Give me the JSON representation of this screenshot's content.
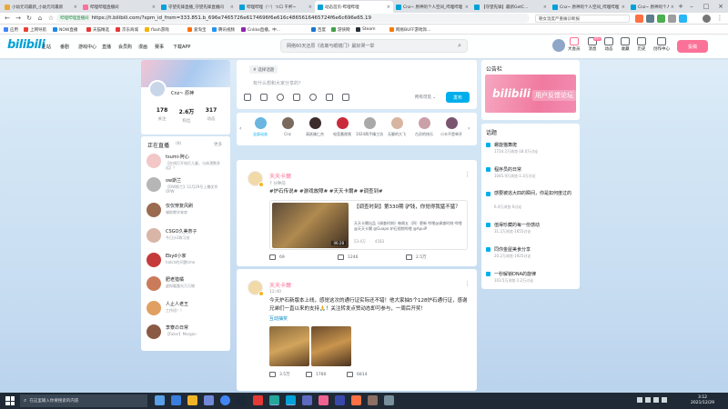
{
  "browser": {
    "tabs": [
      {
        "title": "小幼元司最新_小幼元司最新",
        "color": "#e8a83a"
      },
      {
        "title": "哔哩哔哩直播间",
        "color": "#fb7299"
      },
      {
        "title": "守望先锋直播_守望先锋直播间",
        "color": "#00a1d6"
      },
      {
        "title": "哔哩哔哩（'-'）つロ 干杯~",
        "color": "#00a1d6"
      },
      {
        "title": "动态首页-哔哩哔哩",
        "color": "#00a1d6",
        "active": true
      },
      {
        "title": "Cnz~ 原神的个人空间_哔哩哔哩",
        "color": "#00a1d6"
      },
      {
        "title": "【守望先锋】最新GetC...",
        "color": "#00a1d6"
      },
      {
        "title": "Cnz~ 原神的个人空间_哔哩哔哩",
        "color": "#00a1d6"
      },
      {
        "title": "Cnz~ 原神的个人空间_哔哩哔哩",
        "color": "#00a1d6"
      }
    ],
    "new_tab": "+",
    "url_secure": "哔哩哔哩直播间",
    "url": "https://t.bilibili.com/?spm_id_from=333.851.b_696e7465726e6174696f6e616c4865616465724f6e6c696e65.19",
    "search_hint": "朝女温度严重痛诊断报",
    "bookmarks": [
      {
        "label": "应用",
        "color": "#4285f4"
      },
      {
        "label": "上网导航",
        "color": "#e94235"
      },
      {
        "label": "NOW直播",
        "color": "#1e88e5"
      },
      {
        "label": "天猫精选",
        "color": "#e53935"
      },
      {
        "label": "京东商城",
        "color": "#e53935"
      },
      {
        "label": "flash游戏",
        "color": "#f4b400"
      },
      {
        "label": "爱淘宝",
        "color": "#ff6f00"
      },
      {
        "label": "腾讯视频",
        "color": "#2196f3"
      },
      {
        "label": "Cnlike直播，中...",
        "color": "#8e24aa"
      },
      {
        "label": "百度",
        "color": "#1976d2"
      },
      {
        "label": "游侠网",
        "color": "#43a047"
      },
      {
        "label": "Steam",
        "color": "#263238"
      },
      {
        "label": "网易BUFF游戏饰...",
        "color": "#f57c00"
      }
    ]
  },
  "header": {
    "logo": "bilibili",
    "nav": [
      "主站",
      "番剧",
      "游戏中心",
      "直播",
      "会员购",
      "漫画",
      "赛事",
      "下载APP"
    ],
    "search_placeholder": "网络60天还原《逃离与眼镜门》最好哭一举",
    "right": [
      "大会员",
      "消息",
      "动态",
      "收藏",
      "历史",
      "创作中心"
    ],
    "badge": "99+",
    "contribute": "投稿"
  },
  "profile": {
    "name": "Cnz~ 原神",
    "stats": [
      {
        "value": "178",
        "label": "关注"
      },
      {
        "value": "2.6万",
        "label": "粉丝"
      },
      {
        "value": "317",
        "label": "动态"
      }
    ]
  },
  "live": {
    "title": "正在直播",
    "count": "(8)",
    "more": "更多",
    "items": [
      {
        "name": "tsumi-阿心",
        "desc": "【在线打开电灯儿童，与体漂数多远】？",
        "color": "#f2c7c7"
      },
      {
        "name": "ow斯兰",
        "desc": "【OW斯兰】12月29号上播优秀OPW",
        "color": "#b6b6b6"
      },
      {
        "name": "仅仅穿复风刷",
        "desc": "辅助教学来穿",
        "color": "#9a6b4f"
      },
      {
        "name": "CSGO久美奈子",
        "desc": "今日沙2练习技",
        "color": "#d9b5a8"
      },
      {
        "name": "Ebyd小家",
        "desc": "hatch的开题time",
        "color": "#c53b3b"
      },
      {
        "name": "肥老猎橘",
        "desc": "虚拟暖墨光乃万物",
        "color": "#c97b5a"
      },
      {
        "name": "人止人老王",
        "desc": "工作班！！",
        "color": "#e0a062"
      },
      {
        "name": "李寮の日常",
        "desc": "【Faker】Morgan",
        "color": "#8b5a44"
      }
    ]
  },
  "composer": {
    "tag": "# 选择话题",
    "placeholder": "有什么想和大家分享的？",
    "visibility": "所有可见 ⌄",
    "publish": "发布"
  },
  "uplist": [
    {
      "name": "全部动态",
      "color": "#6bb6e0",
      "selected": true
    },
    {
      "name": "Cnz",
      "color": "#7a6a5e"
    },
    {
      "name": "高跃佛仁杰",
      "color": "#3c2c2c"
    },
    {
      "name": "电竞番视频",
      "color": "#c92b3a"
    },
    {
      "name": "1024两手精工坊",
      "color": "#a9a9a9"
    },
    {
      "name": "无聊的大飞",
      "color": "#d8b5a0"
    },
    {
      "name": "古灵的快乐",
      "color": "#c9a0a8"
    },
    {
      "name": "小丰不是单开",
      "color": "#7a5570"
    }
  ],
  "posts": [
    {
      "author": "天天卡爾",
      "time": "7 分钟前",
      "text": "#炉石传说# #游戏故障# #天天卡爾# #调查到#",
      "video": {
        "title": "【调查时刻】第330期 驴钱，你觉得我猛不猛？",
        "desc": "天天卡爾出品《调查时刻》每周五（四）更新 哔哩@调查时刻 哔哩@天天卡爾 @Guapo 炉石视频哔哩 @ApuiP",
        "duration": "06:28",
        "views": "53.4万",
        "danmaku": "4183"
      },
      "actions": [
        {
          "label": "69",
          "icon": "share-icon"
        },
        {
          "label": "1246",
          "icon": "comment-icon"
        },
        {
          "label": "2.5万",
          "icon": "like-icon"
        }
      ]
    },
    {
      "author": "天天卡爾",
      "time": "12:40",
      "text": "今天炉石新版本上线，感觉这次的通行证实际还不错！他大家抽5个128炉石通行证，感谢兄弟们一直以来的支持🙏！关注转发点赞动态即可参与，一周后开奖！",
      "lottery": "互动抽奖",
      "actions": [
        {
          "label": "3.5万",
          "icon": "share-icon"
        },
        {
          "label": "1780",
          "icon": "comment-icon"
        },
        {
          "label": "6814",
          "icon": "like-icon"
        }
      ]
    }
  ],
  "notice": {
    "title": "公告栏",
    "banner_logo": "bilibili",
    "banner_text": "用户反馈论坛"
  },
  "topics": {
    "title": "话题",
    "items": [
      {
        "name": "螺旋猫舞爬",
        "stats": "1724.2万浏览·18.0万讨论"
      },
      {
        "name": "程序员的日常",
        "stats": "1045.9万浏览·1.3万讨论"
      },
      {
        "name": "感要被逃大四的瞬间，你是如何度过的",
        "stats": "6.4万浏览·0讨论"
      },
      {
        "name": "值得珍藏的每一份感动",
        "stats": "31.2万浏览·1655讨论"
      },
      {
        "name": "同你金屋美食分享",
        "stats": "20.2万浏览·1925讨论"
      },
      {
        "name": "一秒解锁DNA的旋律",
        "stats": "103.5万浏览·1.2万讨论"
      }
    ]
  },
  "taskbar": {
    "search_placeholder": "在这里输入你要搜索的内容",
    "time": "3:12",
    "date": "2021/12/29"
  }
}
